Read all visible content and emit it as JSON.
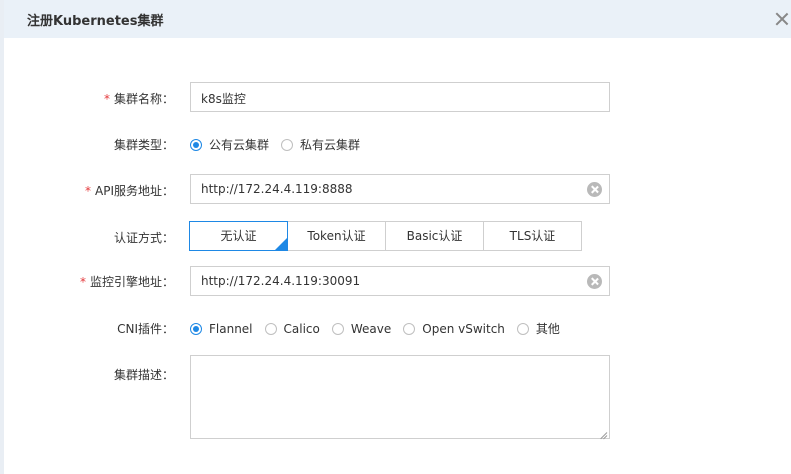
{
  "dialog": {
    "title": "注册Kubernetes集群"
  },
  "form": {
    "required_mark": "*",
    "cluster_name": {
      "label": "集群名称：",
      "value": "k8s监控"
    },
    "cluster_type": {
      "label": "集群类型：",
      "options": [
        "公有云集群",
        "私有云集群"
      ],
      "selected": "公有云集群"
    },
    "api_server": {
      "label": "API服务地址：",
      "value": "http://172.24.4.119:8888"
    },
    "auth_method": {
      "label": "认证方式：",
      "options": [
        "无认证",
        "Token认证",
        "Basic认证",
        "TLS认证"
      ],
      "selected": "无认证"
    },
    "monitor_engine": {
      "label": "监控引擎地址：",
      "value": "http://172.24.4.119:30091"
    },
    "cni_plugin": {
      "label": "CNI插件：",
      "options": [
        "Flannel",
        "Calico",
        "Weave",
        "Open vSwitch",
        "其他"
      ],
      "selected": "Flannel"
    },
    "description": {
      "label": "集群描述：",
      "value": ""
    }
  },
  "colors": {
    "accent": "#1e88e5",
    "required": "#e4393c",
    "header_bg": "#eaf1f8"
  }
}
